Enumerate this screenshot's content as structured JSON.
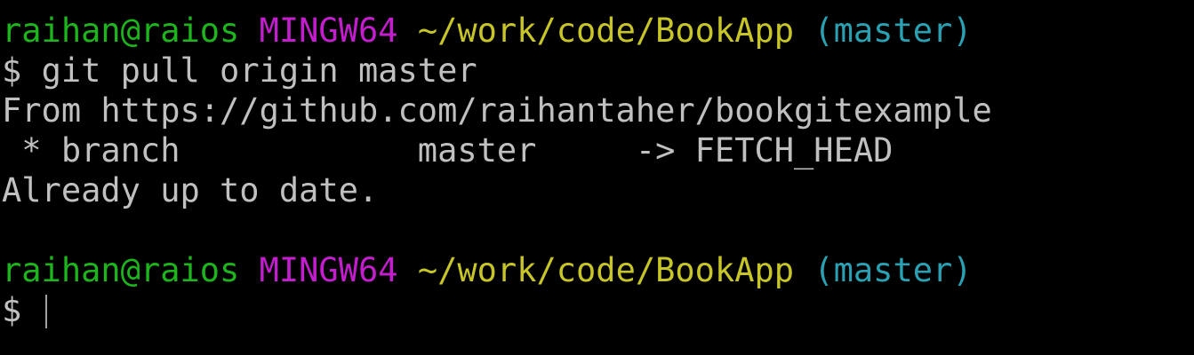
{
  "terminal": {
    "colors": {
      "background": "#000000",
      "text": "#c0c0c0",
      "user": "#1db41d",
      "msystem": "#c31ecd",
      "path": "#c7c528",
      "branch": "#2aa1b3"
    },
    "prompt1": {
      "user_host": "raihan@raios",
      "msystem": "MINGW64",
      "path": "~/work/code/BookApp",
      "branch": "(master)"
    },
    "command_line": {
      "symbol": "$",
      "command": "git pull origin master"
    },
    "output": [
      "From https://github.com/raihantaher/bookgitexample",
      " * branch            master     -> FETCH_HEAD",
      "Already up to date."
    ],
    "prompt2": {
      "user_host": "raihan@raios",
      "msystem": "MINGW64",
      "path": "~/work/code/BookApp",
      "branch": "(master)"
    },
    "input_line": {
      "symbol": "$",
      "value": ""
    }
  }
}
